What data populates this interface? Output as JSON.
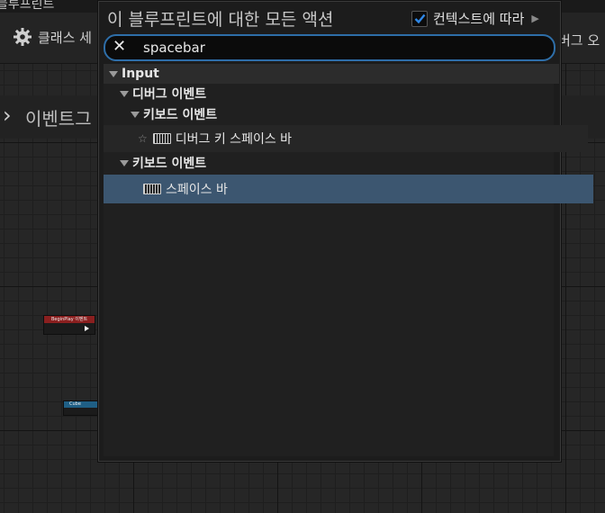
{
  "top_strip_text": "블루프린트",
  "toolbar": {
    "class_settings_label": "클래스 세",
    "class_defaults_label": "버그 오"
  },
  "graph_tab": {
    "label": "이벤트그"
  },
  "nodes": {
    "begin_play_title": "BeginPlay 이벤트",
    "cube_title": "Cube"
  },
  "popup": {
    "title": "이 블루프린트에 대한 모든 액션",
    "context_label": "컨텍스트에 따라",
    "context_checked": true,
    "search_value": "spacebar",
    "tree": {
      "input_label": "Input",
      "debug_events_label": "디버그 이벤트",
      "debug_keyboard_events_label": "키보드 이벤트",
      "debug_key_spacebar_label": "디버그 키 스페이스 바",
      "keyboard_events_label": "키보드 이벤트",
      "spacebar_label": "스페이스 바"
    }
  },
  "colors": {
    "accent": "#2e6ea8",
    "selection": "#3c5670",
    "checkbox": "#2f88e8"
  }
}
